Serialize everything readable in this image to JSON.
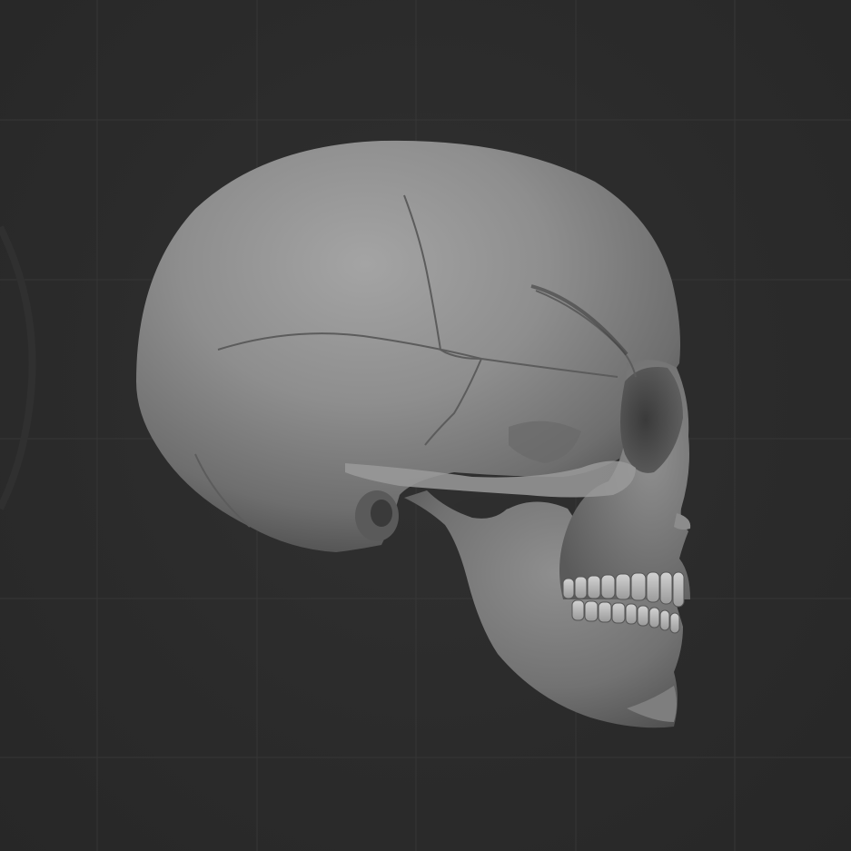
{
  "viewport": {
    "background_color": "#2b2b2b",
    "grid_color": "#3a3a3a",
    "grid_visible": true
  },
  "model": {
    "subject": "skull",
    "view": "side",
    "material_base_color": "#8a8a8a",
    "material_highlight_color": "#a6a6a6",
    "material_shadow_color": "#3e3e3e",
    "tooth_color": "#c8c8c8"
  }
}
